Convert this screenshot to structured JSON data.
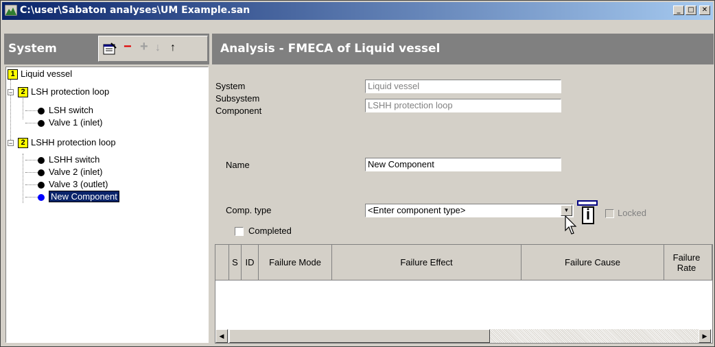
{
  "window": {
    "title": "C:\\user\\Sabaton analyses\\UM Example.san"
  },
  "left": {
    "header_title": "System",
    "tree": [
      {
        "level": "1",
        "label": "Liquid vessel"
      },
      {
        "level": "2",
        "label": "LSH protection loop"
      },
      {
        "label": "LSH switch"
      },
      {
        "label": "Valve 1 (inlet)"
      },
      {
        "level": "2",
        "label": "LSHH protection loop"
      },
      {
        "label": "LSHH switch"
      },
      {
        "label": "Valve 2 (inlet)"
      },
      {
        "label": "Valve 3 (outlet)"
      },
      {
        "label": "New Component"
      }
    ]
  },
  "right": {
    "header_title": "Analysis - FMECA of Liquid vessel",
    "labels": {
      "system": "System",
      "subsystem": "Subsystem",
      "component": "Component",
      "name": "Name",
      "comp_type": "Comp. type",
      "completed": "Completed",
      "locked": "Locked"
    },
    "values": {
      "system": "Liquid vessel",
      "subsystem": "LSHH protection loop",
      "name": "New Component",
      "comp_type": "<Enter component type>"
    },
    "grid_headers": [
      "S",
      "ID",
      "Failure Mode",
      "Failure Effect",
      "Failure Cause",
      "Failure Rate"
    ]
  },
  "colors": {
    "title_start": "#0a246a",
    "title_end": "#a6caf0",
    "header_bg": "#808080",
    "selection": "#0a246a",
    "level_box": "#ffff00",
    "new_dot": "#0000ff"
  }
}
